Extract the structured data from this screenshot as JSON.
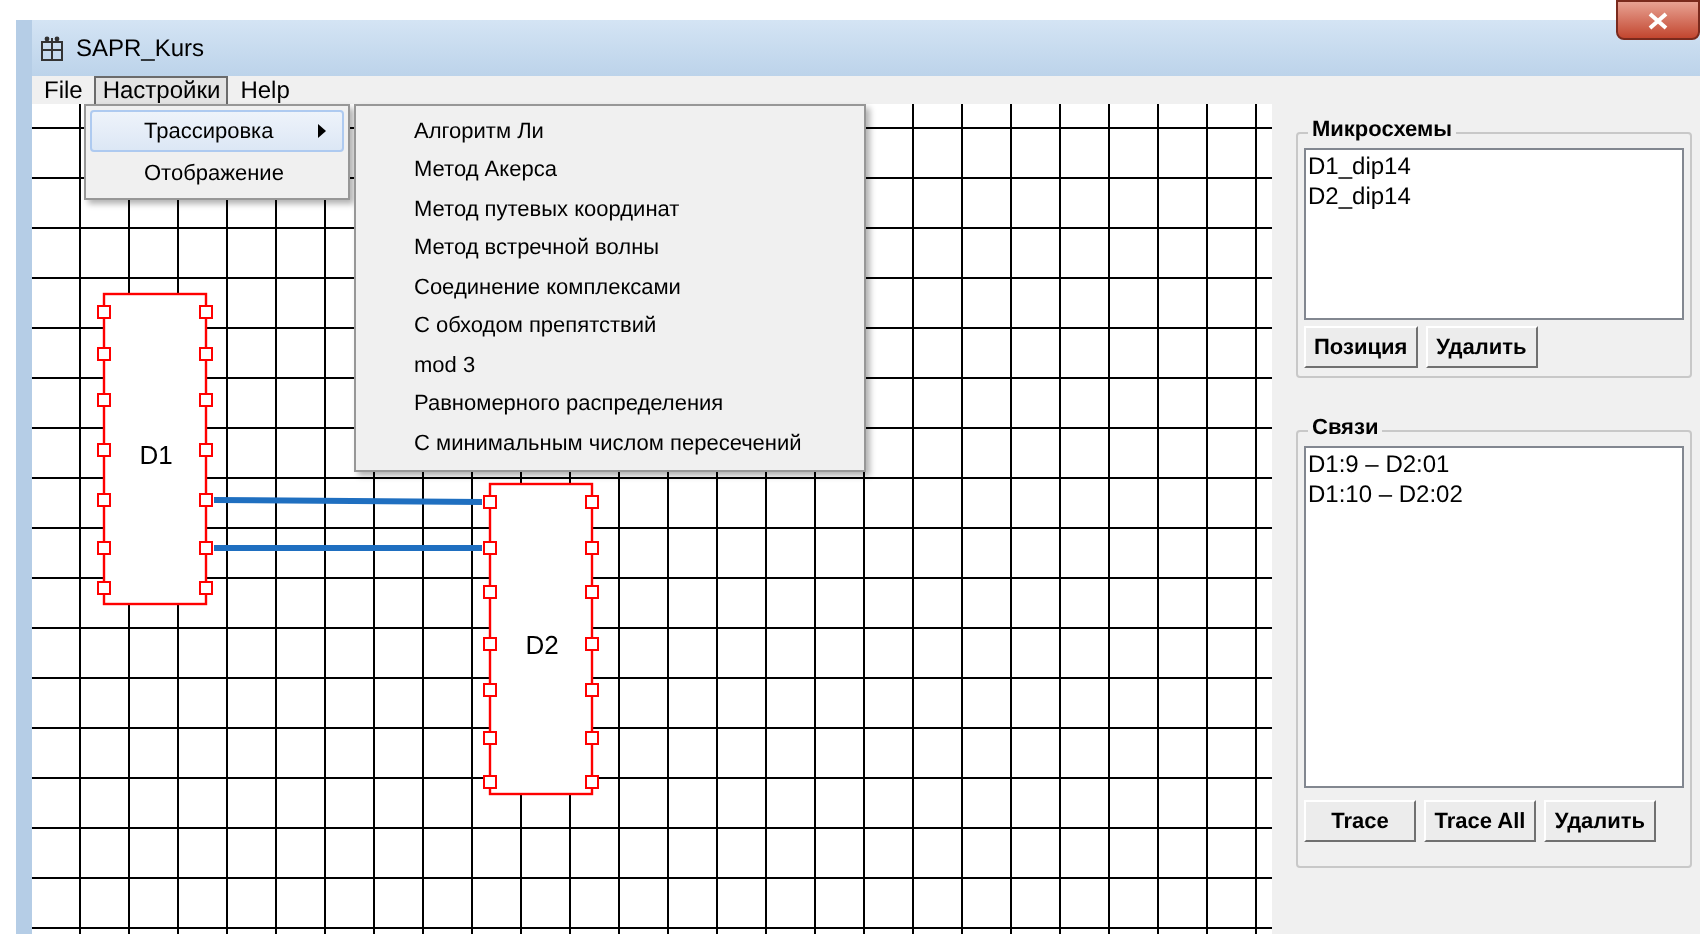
{
  "window": {
    "title": "SAPR_Kurs"
  },
  "menu_bar": [
    {
      "label": "File",
      "selected": false
    },
    {
      "label": "Настройки",
      "selected": true
    },
    {
      "label": "Help",
      "selected": false
    }
  ],
  "dropdown": {
    "items": [
      {
        "label": "Трассировка",
        "selected": true,
        "has_submenu": true
      },
      {
        "label": "Отображение",
        "selected": false,
        "has_submenu": false
      }
    ]
  },
  "submenu": {
    "items": [
      "Алгоритм Ли",
      "Метод Акерса",
      "Метод путевых координат",
      "Метод встречной волны",
      "Соединение комплексами",
      "С обходом препятствий",
      "mod 3",
      "Равномерного распределения",
      "С минимальным числом пересечений"
    ]
  },
  "canvas": {
    "chips": [
      {
        "label": "D1"
      },
      {
        "label": "D2"
      }
    ]
  },
  "chips_panel": {
    "title": "Микросхемы",
    "items": [
      "D1_dip14",
      "D2_dip14"
    ],
    "buttons": [
      "Позиция",
      "Удалить"
    ]
  },
  "links_panel": {
    "title": "Связи",
    "items": [
      "D1:9 – D2:01",
      "D1:10 – D2:02"
    ],
    "buttons": [
      "Trace",
      "Trace All",
      "Удалить"
    ]
  }
}
